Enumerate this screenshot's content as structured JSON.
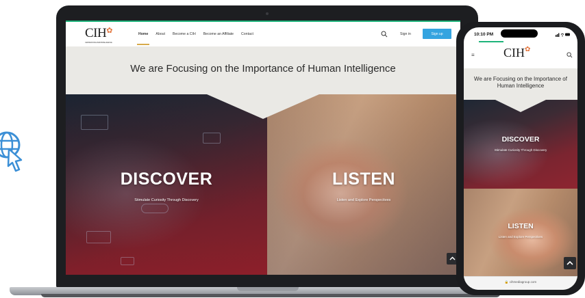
{
  "laptop": {
    "site": {
      "logo_text": "CIH",
      "logo_tagline": "CENTER FOR HUMAN INTELLIGENCE",
      "nav": [
        {
          "label": "Home",
          "active": true
        },
        {
          "label": "About"
        },
        {
          "label": "Become a CIH"
        },
        {
          "label": "Become an Affiliate"
        },
        {
          "label": "Contact"
        }
      ],
      "signin_label": "Sign in",
      "signup_label": "Sign up",
      "hero_title": "We are Focusing on the Importance of Human Intelligence",
      "discover_title": "DISCOVER",
      "discover_subtitle": "Stimulate Curiosity Through Discovery",
      "listen_title": "LISTEN",
      "listen_subtitle": "Listen and Explore Perspectives"
    }
  },
  "phone": {
    "time": "10:10 PM",
    "status_icons": "signal-wifi-battery",
    "logo_text": "CIH",
    "hero_title": "We are Focusing on the Importance of Human Intelligence",
    "discover_title": "DISCOVER",
    "discover_subtitle": "Stimulate Curiosity Through Discovery",
    "listen_title": "LISTEN",
    "listen_subtitle": "Listen and Explore Perspectives",
    "url": "cihmediagroup.com"
  },
  "colors": {
    "accent_green": "#1db37a",
    "signup_blue": "#34a4e0",
    "nav_underline": "#d7aa4b",
    "icon_blue": "#3b8fd6"
  },
  "icons": [
    "web-cursor-icon",
    "search-icon",
    "menu-icon",
    "chevron-up-icon",
    "lock-icon"
  ]
}
